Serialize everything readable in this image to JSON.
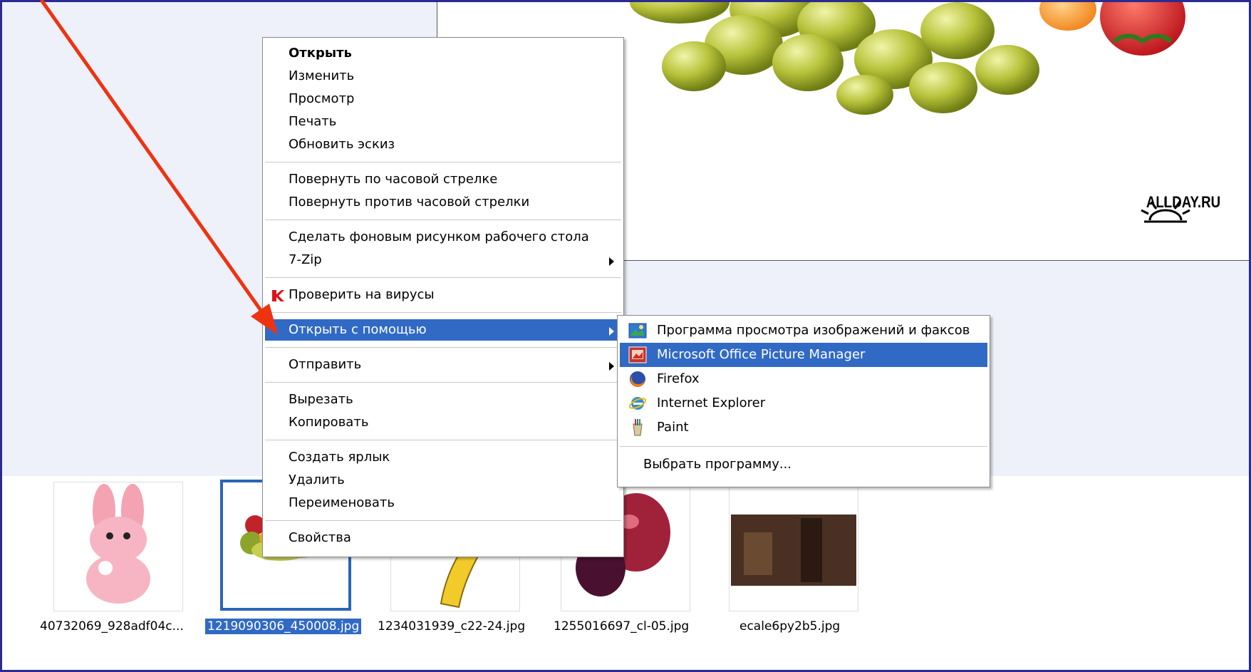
{
  "preview": {
    "logo_text": "ALLDAY.RU"
  },
  "context_menu": {
    "items": [
      {
        "label": "Открыть"
      },
      {
        "label": "Изменить"
      },
      {
        "label": "Просмотр"
      },
      {
        "label": "Печать"
      },
      {
        "label": "Обновить эскиз"
      },
      {
        "label": "Повернуть по часовой стрелке"
      },
      {
        "label": "Повернуть против часовой стрелки"
      },
      {
        "label": "Сделать фоновым рисунком рабочего стола"
      },
      {
        "label": "7-Zip"
      },
      {
        "label": "Проверить на вирусы"
      },
      {
        "label": "Открыть с помощью"
      },
      {
        "label": "Отправить"
      },
      {
        "label": "Вырезать"
      },
      {
        "label": "Копировать"
      },
      {
        "label": "Создать ярлык"
      },
      {
        "label": "Удалить"
      },
      {
        "label": "Переименовать"
      },
      {
        "label": "Свойства"
      }
    ]
  },
  "open_with_submenu": {
    "items": [
      {
        "label": "Программа просмотра изображений и факсов",
        "icon": "image-viewer-icon"
      },
      {
        "label": "Microsoft Office Picture Manager",
        "icon": "picture-manager-icon"
      },
      {
        "label": "Firefox",
        "icon": "firefox-icon"
      },
      {
        "label": "Internet Explorer",
        "icon": "internet-explorer-icon"
      },
      {
        "label": "Paint",
        "icon": "paint-icon"
      },
      {
        "label": "Выбрать программу..."
      }
    ]
  },
  "thumbnails": [
    {
      "caption": "40732069_928adf04c..."
    },
    {
      "caption": "1219090306_450008.jpg"
    },
    {
      "caption": "1234031939_c22-24.jpg"
    },
    {
      "caption": "1255016697_cl-05.jpg"
    },
    {
      "caption": "ecale6py2b5.jpg"
    }
  ],
  "colors": {
    "highlight": "#316ac5",
    "frame_border": "#2b2b8f",
    "arrow": "#ee3311"
  }
}
